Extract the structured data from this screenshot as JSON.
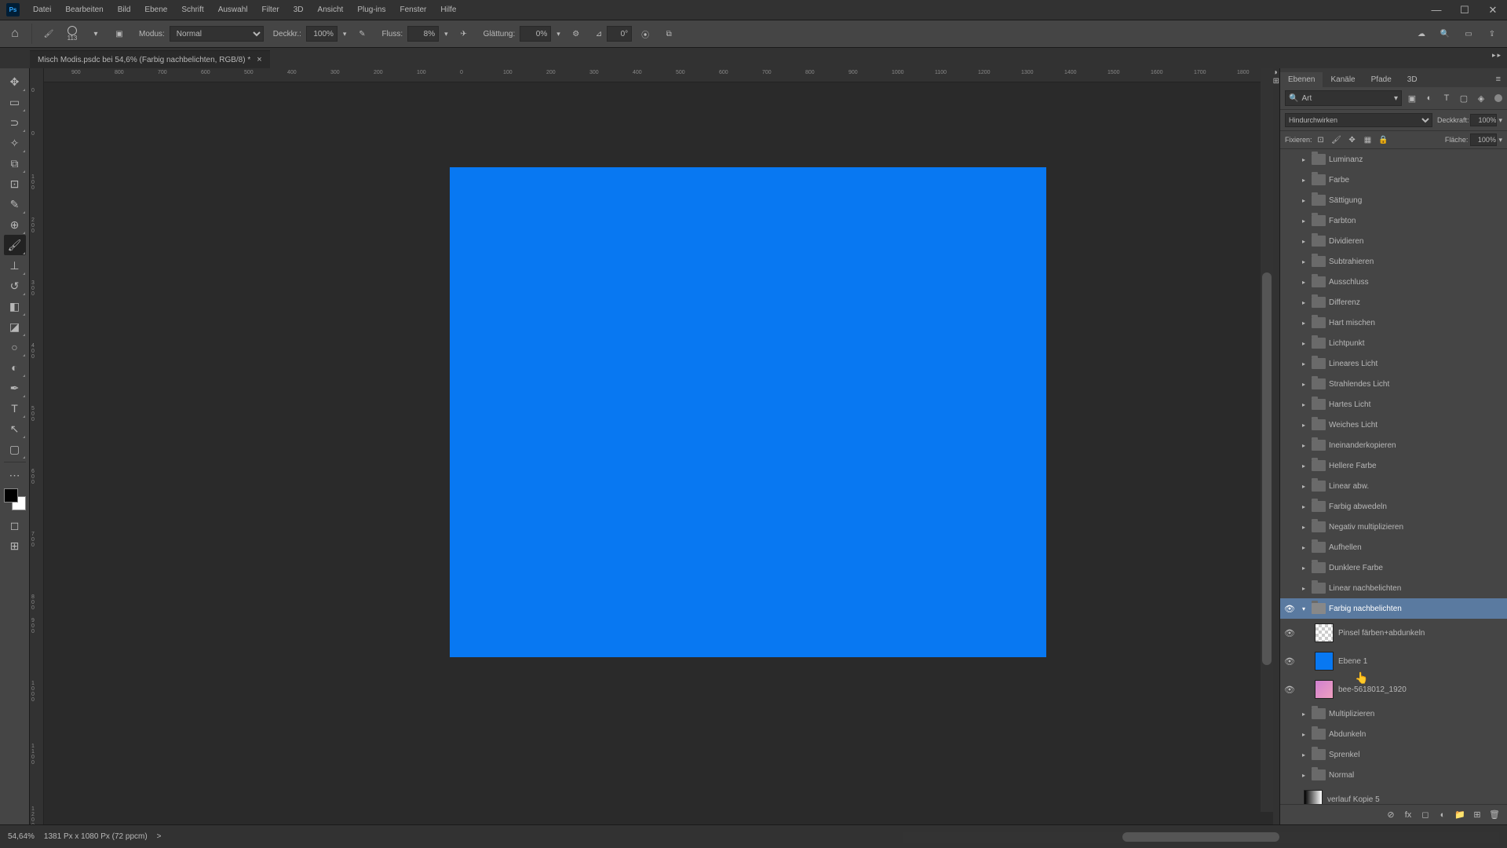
{
  "app": {
    "logo": "Ps"
  },
  "menu": [
    "Datei",
    "Bearbeiten",
    "Bild",
    "Ebene",
    "Schrift",
    "Auswahl",
    "Filter",
    "3D",
    "Ansicht",
    "Plug-ins",
    "Fenster",
    "Hilfe"
  ],
  "win_controls": {
    "min": "—",
    "max": "☐",
    "close": "✕"
  },
  "optbar": {
    "home": "⌂",
    "brush_size": "113",
    "mode_label": "Modus:",
    "mode_value": "Normal",
    "deckkr_label": "Deckkr.:",
    "deckkr_value": "100%",
    "fluss_label": "Fluss:",
    "fluss_value": "8%",
    "glatt_label": "Glättung:",
    "glatt_value": "0%",
    "angle_label": "⊿",
    "angle_value": "0°"
  },
  "doc": {
    "tab_title": "Misch Modis.psdc bei 54,6% (Farbig nachbelichten, RGB/8) *",
    "close_x": "×"
  },
  "hruler_ticks": [
    {
      "label": "900",
      "pos": 35
    },
    {
      "label": "800",
      "pos": 90
    },
    {
      "label": "700",
      "pos": 145
    },
    {
      "label": "600",
      "pos": 200
    },
    {
      "label": "500",
      "pos": 255
    },
    {
      "label": "400",
      "pos": 310
    },
    {
      "label": "300",
      "pos": 365
    },
    {
      "label": "200",
      "pos": 420
    },
    {
      "label": "100",
      "pos": 475
    },
    {
      "label": "0",
      "pos": 530
    },
    {
      "label": "100",
      "pos": 585
    },
    {
      "label": "200",
      "pos": 640
    },
    {
      "label": "300",
      "pos": 695
    },
    {
      "label": "400",
      "pos": 750
    },
    {
      "label": "500",
      "pos": 805
    },
    {
      "label": "600",
      "pos": 860
    },
    {
      "label": "700",
      "pos": 915
    },
    {
      "label": "800",
      "pos": 970
    },
    {
      "label": "900",
      "pos": 1025
    },
    {
      "label": "1000",
      "pos": 1080
    },
    {
      "label": "1100",
      "pos": 1135
    },
    {
      "label": "1200",
      "pos": 1190
    },
    {
      "label": "1300",
      "pos": 1245
    },
    {
      "label": "1400",
      "pos": 1300
    },
    {
      "label": "1500",
      "pos": 1355
    },
    {
      "label": "1600",
      "pos": 1410
    },
    {
      "label": "1700",
      "pos": 1465
    },
    {
      "label": "1800",
      "pos": 1520
    }
  ],
  "vruler_ticks": [
    {
      "label": "0",
      "pos": 25
    },
    {
      "label": "0",
      "pos": 80
    },
    {
      "label": "1\n0\n0",
      "pos": 135
    },
    {
      "label": "2\n0\n0",
      "pos": 190
    },
    {
      "label": "3\n0\n0",
      "pos": 270
    },
    {
      "label": "4\n0\n0",
      "pos": 350
    },
    {
      "label": "5\n0\n0",
      "pos": 430
    },
    {
      "label": "6\n0\n0",
      "pos": 510
    },
    {
      "label": "7\n0\n0",
      "pos": 590
    },
    {
      "label": "8\n0\n0",
      "pos": 670
    },
    {
      "label": "9\n0\n0",
      "pos": 700
    },
    {
      "label": "1\n0\n0\n0",
      "pos": 780
    },
    {
      "label": "1\n1\n0\n0",
      "pos": 860
    },
    {
      "label": "1\n2\n0\n0",
      "pos": 940
    }
  ],
  "canvas": {
    "fill": "#0878f2"
  },
  "panel": {
    "tabs": [
      "Ebenen",
      "Kanäle",
      "Pfade",
      "3D"
    ],
    "active_tab": 0,
    "search_placeholder": "Art",
    "blend_mode": "Hindurchwirken",
    "deckkraft_label": "Deckkraft:",
    "deckkraft_value": "100%",
    "fixieren_label": "Fixieren:",
    "flaeche_label": "Fläche:",
    "flaeche_value": "100%"
  },
  "layers": [
    {
      "type": "group",
      "name": "Luminanz",
      "vis": false
    },
    {
      "type": "group",
      "name": "Farbe",
      "vis": false
    },
    {
      "type": "group",
      "name": "Sättigung",
      "vis": false
    },
    {
      "type": "group",
      "name": "Farbton",
      "vis": false
    },
    {
      "type": "group",
      "name": "Dividieren",
      "vis": false
    },
    {
      "type": "group",
      "name": "Subtrahieren",
      "vis": false
    },
    {
      "type": "group",
      "name": "Ausschluss",
      "vis": false
    },
    {
      "type": "group",
      "name": "Differenz",
      "vis": false
    },
    {
      "type": "group",
      "name": "Hart mischen",
      "vis": false
    },
    {
      "type": "group",
      "name": "Lichtpunkt",
      "vis": false
    },
    {
      "type": "group",
      "name": "Lineares Licht",
      "vis": false
    },
    {
      "type": "group",
      "name": "Strahlendes Licht",
      "vis": false
    },
    {
      "type": "group",
      "name": "Hartes Licht",
      "vis": false
    },
    {
      "type": "group",
      "name": "Weiches Licht",
      "vis": false
    },
    {
      "type": "group",
      "name": "Ineinanderkopieren",
      "vis": false
    },
    {
      "type": "group",
      "name": "Hellere Farbe",
      "vis": false
    },
    {
      "type": "group",
      "name": "Linear abw.",
      "vis": false
    },
    {
      "type": "group",
      "name": "Farbig abwedeln",
      "vis": false
    },
    {
      "type": "group",
      "name": "Negativ multiplizieren",
      "vis": false
    },
    {
      "type": "group",
      "name": "Aufhellen",
      "vis": false
    },
    {
      "type": "group",
      "name": "Dunklere Farbe",
      "vis": false
    },
    {
      "type": "group",
      "name": "Linear nachbelichten",
      "vis": false
    },
    {
      "type": "group",
      "name": "Farbig nachbelichten",
      "vis": true,
      "selected": true,
      "expanded": true
    },
    {
      "type": "layer",
      "name": "Pinsel färben+abdunkeln",
      "vis": true,
      "thumb": "checker",
      "indent": 1
    },
    {
      "type": "layer",
      "name": "Ebene 1",
      "vis": true,
      "thumb": "blue",
      "indent": 1
    },
    {
      "type": "layer",
      "name": "bee-5618012_1920",
      "vis": true,
      "thumb": "bee",
      "indent": 1
    },
    {
      "type": "group",
      "name": "Multiplizieren",
      "vis": false
    },
    {
      "type": "group",
      "name": "Abdunkeln",
      "vis": false
    },
    {
      "type": "group",
      "name": "Sprenkel",
      "vis": false
    },
    {
      "type": "group",
      "name": "Normal",
      "vis": false
    },
    {
      "type": "layer",
      "name": "verlauf Kopie 5",
      "vis": false,
      "thumb": "grad",
      "indent": 0
    }
  ],
  "status": {
    "zoom": "54,64%",
    "doc_info": "1381 Px x 1080 Px (72 ppcm)",
    "arrow": ">"
  }
}
